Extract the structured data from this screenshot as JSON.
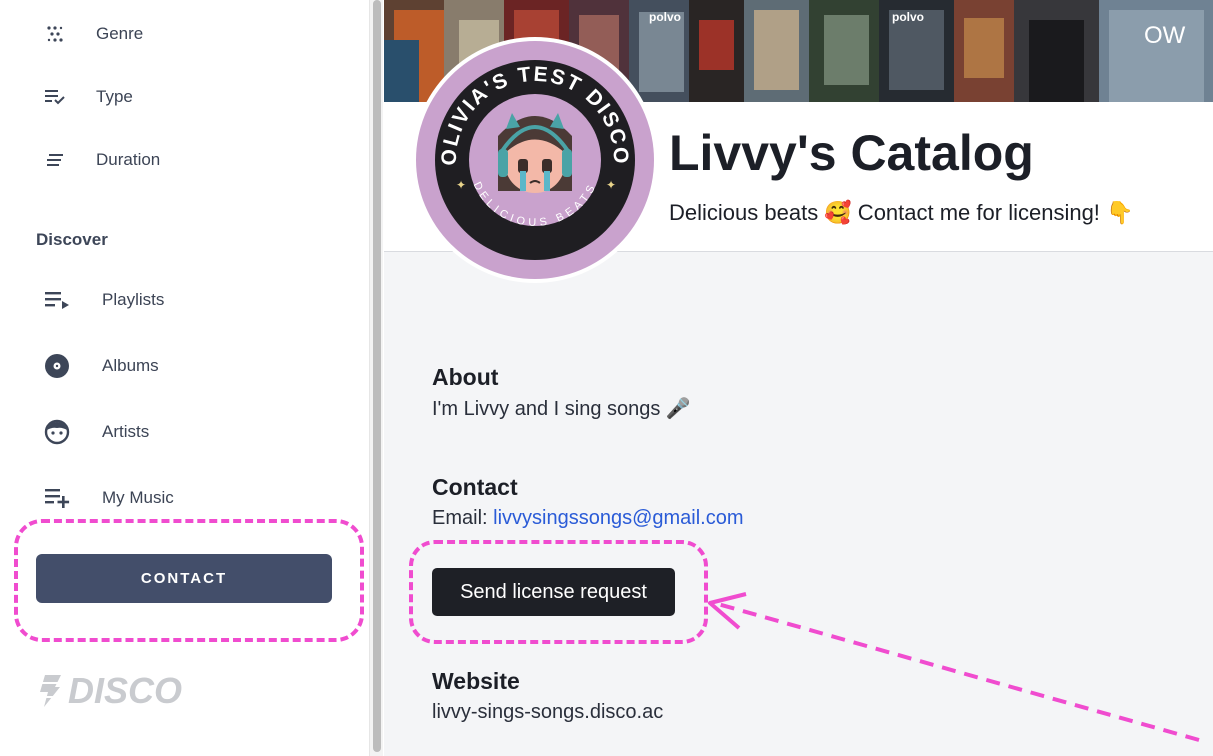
{
  "sidebar": {
    "filters": [
      {
        "label": "Genre",
        "icon": "genre-dots-icon"
      },
      {
        "label": "Type",
        "icon": "type-list-check-icon"
      },
      {
        "label": "Duration",
        "icon": "duration-lines-icon"
      }
    ],
    "discover_title": "Discover",
    "discover": [
      {
        "label": "Playlists",
        "icon": "playlist-icon"
      },
      {
        "label": "Albums",
        "icon": "album-disc-icon"
      },
      {
        "label": "Artists",
        "icon": "artist-face-icon"
      },
      {
        "label": "My Music",
        "icon": "playlist-add-icon"
      }
    ],
    "contact_label": "CONTACT",
    "logo_text": "DISCO"
  },
  "profile": {
    "title": "Livvy's Catalog",
    "subtitle": "Delicious beats 🥰 Contact me for licensing! 👇",
    "avatar_ring_text": "OLIVIA'S TEST DISCO",
    "avatar_bottom_text": "DELICIOUS BEATS"
  },
  "banner": {
    "label_1": "polvo",
    "label_2": "polvo",
    "label_3": "OW"
  },
  "about": {
    "heading": "About",
    "text": "I'm Livvy and I sing songs 🎤"
  },
  "contact": {
    "heading": "Contact",
    "email_label": "Email:",
    "email": "livvysingssongs@gmail.com",
    "license_button": "Send license request"
  },
  "website": {
    "heading": "Website",
    "url": "livvy-sings-songs.disco.ac"
  },
  "colors": {
    "contact_button": "#434e6a",
    "highlight": "#f04ccf",
    "link": "#2a5bd7",
    "avatar_bg": "#c9a2cd"
  }
}
